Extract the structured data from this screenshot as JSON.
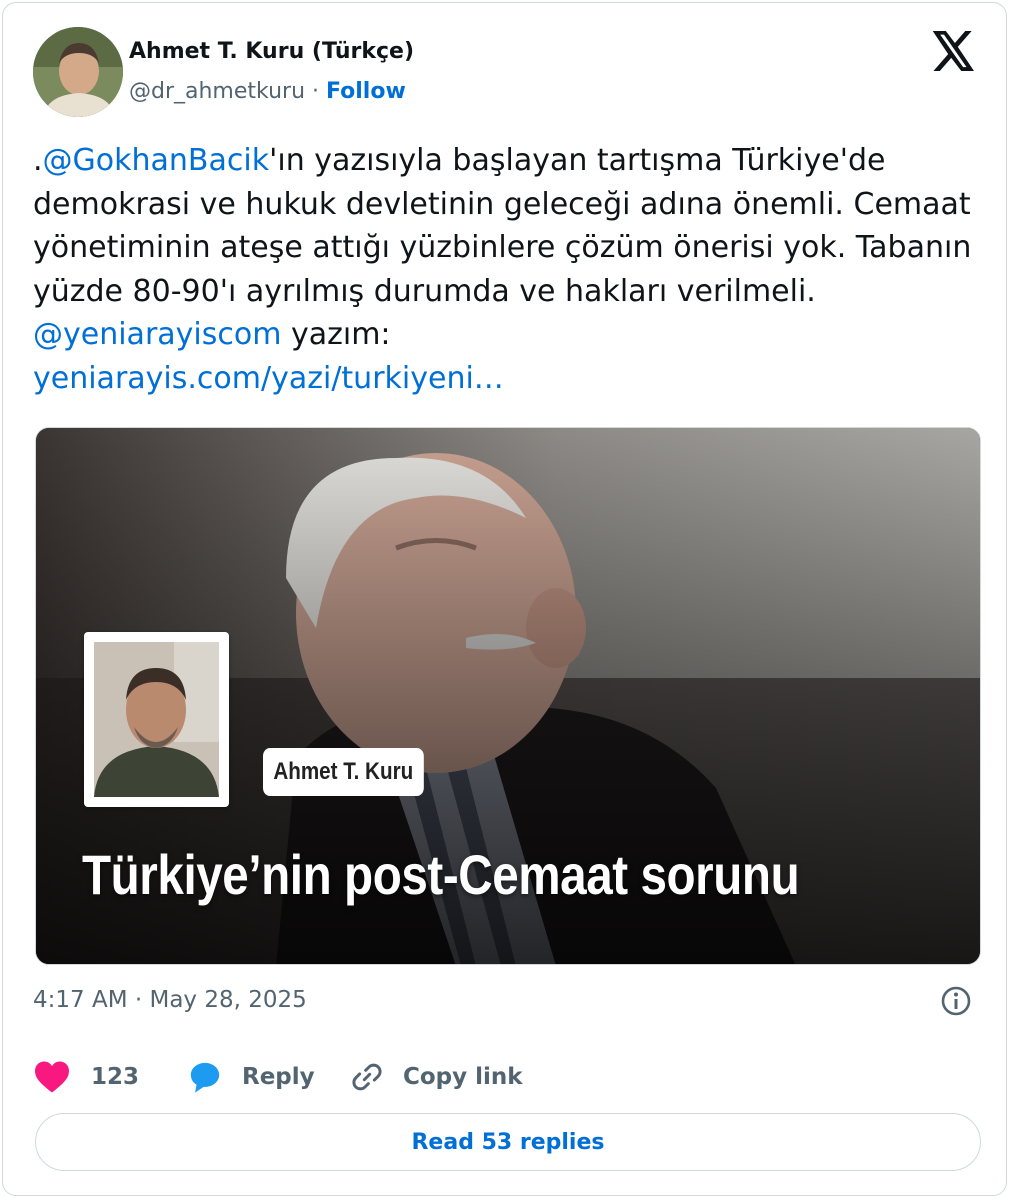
{
  "author": {
    "display_name": "Ahmet T. Kuru (Türkçe)",
    "handle": "@dr_ahmetkuru",
    "separator": " · ",
    "follow_label": "Follow"
  },
  "tweet": {
    "prefix": ".",
    "mention1": "@GokhanBacik",
    "text1": "'ın yazısıyla başlayan tartışma Türkiye'de demokrasi ve hukuk devletinin geleceği adına önemli. Cemaat yönetiminin ateşe attığı yüzbinlere çözüm önerisi yok. Tabanın yüzde 80-90'ı ayrılmış durumda ve hakları verilmeli. ",
    "mention2": "@yeniarayiscom",
    "text2": " yazım:",
    "link": "yeniarayis.com/yazi/turkiyeni…"
  },
  "media": {
    "author_badge": "Ahmet T. Kuru",
    "headline": "Türkiye’nin post-Cemaat sorunu"
  },
  "timestamp": "4:17 AM · May 28, 2025",
  "actions": {
    "likes_count": "123",
    "reply_label": "Reply",
    "copy_link_label": "Copy link"
  },
  "read_replies_label": "Read 53 replies",
  "colors": {
    "link": "#006fd6",
    "heart": "#f91880",
    "reply": "#1d9bf0",
    "muted": "#536471"
  },
  "icons": [
    "x-logo-icon",
    "info-icon",
    "heart-icon",
    "reply-bubble-icon",
    "link-icon"
  ]
}
